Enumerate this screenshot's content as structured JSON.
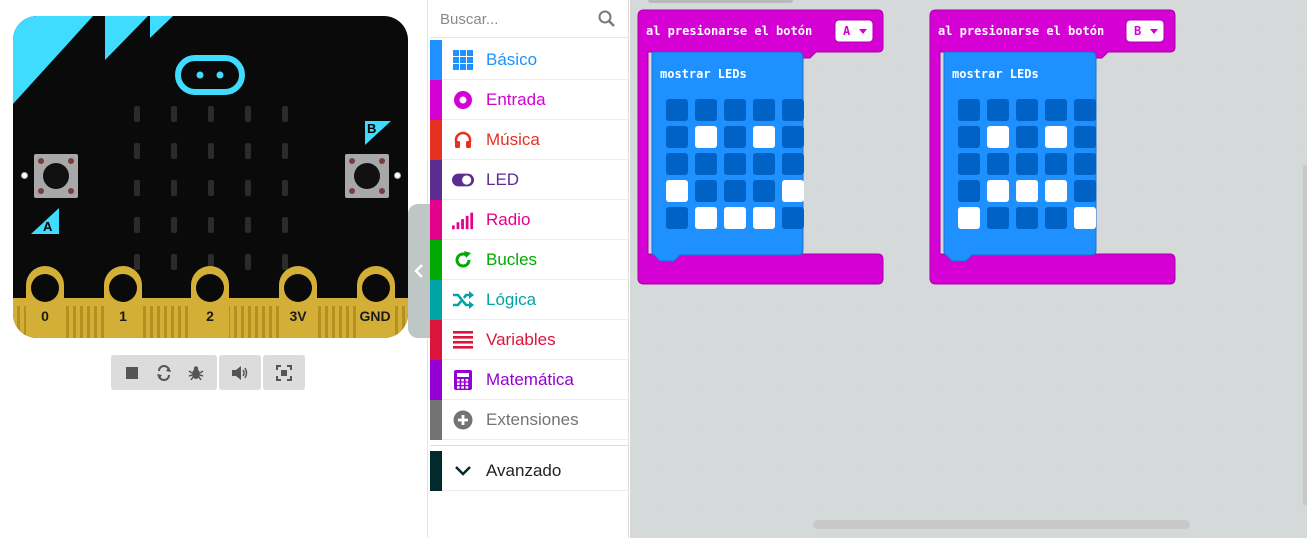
{
  "simulator": {
    "button_a_label": "A",
    "button_b_label": "B",
    "pins": [
      "0",
      "1",
      "2",
      "3V",
      "GND"
    ],
    "toolbar_icons": [
      "stop-icon",
      "restart-icon",
      "debug-icon",
      "sound-icon",
      "fullscreen-icon"
    ]
  },
  "toolbox": {
    "search_placeholder": "Buscar...",
    "categories": [
      {
        "label": "Básico",
        "color": "#1e90ff",
        "icon": "grid-icon"
      },
      {
        "label": "Entrada",
        "color": "#d400d4",
        "icon": "target-icon"
      },
      {
        "label": "Música",
        "color": "#e63022",
        "icon": "headphones-icon"
      },
      {
        "label": "LED",
        "color": "#5c2d91",
        "icon": "toggle-icon"
      },
      {
        "label": "Radio",
        "color": "#e3008c",
        "icon": "signal-icon"
      },
      {
        "label": "Bucles",
        "color": "#00aa00",
        "icon": "refresh-icon"
      },
      {
        "label": "Lógica",
        "color": "#00a4a6",
        "icon": "shuffle-icon"
      },
      {
        "label": "Variables",
        "color": "#dc143c",
        "icon": "lines-icon"
      },
      {
        "label": "Matemática",
        "color": "#9400d3",
        "icon": "calculator-icon"
      },
      {
        "label": "Extensiones",
        "color": "#737373",
        "icon": "plus-circle-icon"
      }
    ],
    "advanced": {
      "label": "Avanzado",
      "color": "#012a2d",
      "icon": "chevron-down-icon"
    }
  },
  "workspace": {
    "blocks": [
      {
        "event_label": "al presionarse el botón",
        "button": "A",
        "inner_label": "mostrar LEDs",
        "leds": [
          [
            0,
            0,
            0,
            0,
            0
          ],
          [
            0,
            1,
            0,
            1,
            0
          ],
          [
            0,
            0,
            0,
            0,
            0
          ],
          [
            1,
            0,
            0,
            0,
            1
          ],
          [
            0,
            1,
            1,
            1,
            0
          ]
        ]
      },
      {
        "event_label": "al presionarse el botón",
        "button": "B",
        "inner_label": "mostrar LEDs",
        "leds": [
          [
            0,
            0,
            0,
            0,
            0
          ],
          [
            0,
            1,
            0,
            1,
            0
          ],
          [
            0,
            0,
            0,
            0,
            0
          ],
          [
            0,
            1,
            1,
            1,
            0
          ],
          [
            1,
            0,
            0,
            0,
            1
          ]
        ]
      }
    ]
  },
  "colors": {
    "input_block": "#d400d4",
    "basic_block": "#1e90ff",
    "led_off": "#0062c4",
    "led_on": "#ffffff",
    "board_accent": "#3fdcff",
    "pin_gold": "#d4af37"
  }
}
